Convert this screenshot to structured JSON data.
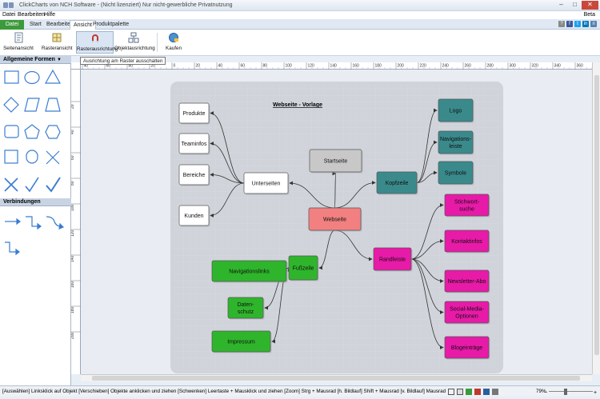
{
  "title": "ClickCharts von NCH Software - (Nicht lizenziert) Nur nicht-gewerbliche Privatnutzung",
  "menu": {
    "datei": "Datei",
    "bearbeiten": "Bearbeiten",
    "hilfe": "Hilfe",
    "beta": "Beta"
  },
  "tabs": [
    "Datei",
    "Start",
    "Bearbeiten",
    "Ansicht",
    "Produktpalette"
  ],
  "active_tab": "Ansicht",
  "ribbon": {
    "seitenansicht": "Seitenansicht",
    "rasteransicht": "Rasteransicht",
    "rasterausrichtung": "Rasterausrichtung",
    "objektausrichtung": "Objektausrichtung",
    "kaufen": "Kaufen"
  },
  "tooltip": "Ausrichtung am Raster ausschalten",
  "left_panel": {
    "shapes_header": "Allgemeine Formen",
    "connections_header": "Verbindungen"
  },
  "ruler": {
    "top": [
      "40",
      "60",
      "80",
      "20",
      "0",
      "20",
      "40",
      "60",
      "80",
      "100",
      "120",
      "140",
      "160",
      "180",
      "200",
      "220",
      "240",
      "260",
      "280",
      "300",
      "320",
      "340",
      "360"
    ],
    "left": [
      "20",
      "40",
      "60",
      "80",
      "100",
      "120",
      "140",
      "160",
      "180",
      "200"
    ]
  },
  "diagram": {
    "title": "Webseite - Vorlage",
    "center": "Webseite",
    "startseite": "Startseite",
    "unterseiten": "Unterseiten",
    "unterseiten_items": [
      "Produkte",
      "Teaminfos",
      "Bereiche",
      "Kunden"
    ],
    "kopfzeile": "Kopfzeile",
    "kopfzeile_items": [
      [
        "Logo"
      ],
      [
        "Navigations-",
        "leiste"
      ],
      [
        "Symbole"
      ]
    ],
    "fusszeile": "Fußzeile",
    "fusszeile_items": [
      [
        "Navigationslinks"
      ],
      [
        "Daten-",
        "schutz"
      ],
      [
        "Impressum"
      ]
    ],
    "randleiste": "Randleiste",
    "randleiste_items": [
      [
        "Stichwort-",
        "suche"
      ],
      [
        "Kontaktinfos"
      ],
      [
        "Newsletter-Abo"
      ],
      [
        "Social-Media-",
        "Optionen"
      ],
      [
        "Blogeinträge"
      ]
    ]
  },
  "status": "[Auswählen] Linksklick auf Objekt [Verschieben] Objekte anklicken und ziehen [Schwenken] Leertaste + Mausklick und ziehen [Zoom] Strg + Mausrad [h. Bildlauf] Shift + Mausrad [v. Bildlauf] Mausrad",
  "zoom": "79%",
  "colors": {
    "center": "#f28080",
    "startseite": "#c8c8c8",
    "teal": "#3a8a8c",
    "pink": "#e81aa8",
    "green": "#2fb52c",
    "white": "#ffffff",
    "accent_file_tab": "#3c9a3a"
  }
}
